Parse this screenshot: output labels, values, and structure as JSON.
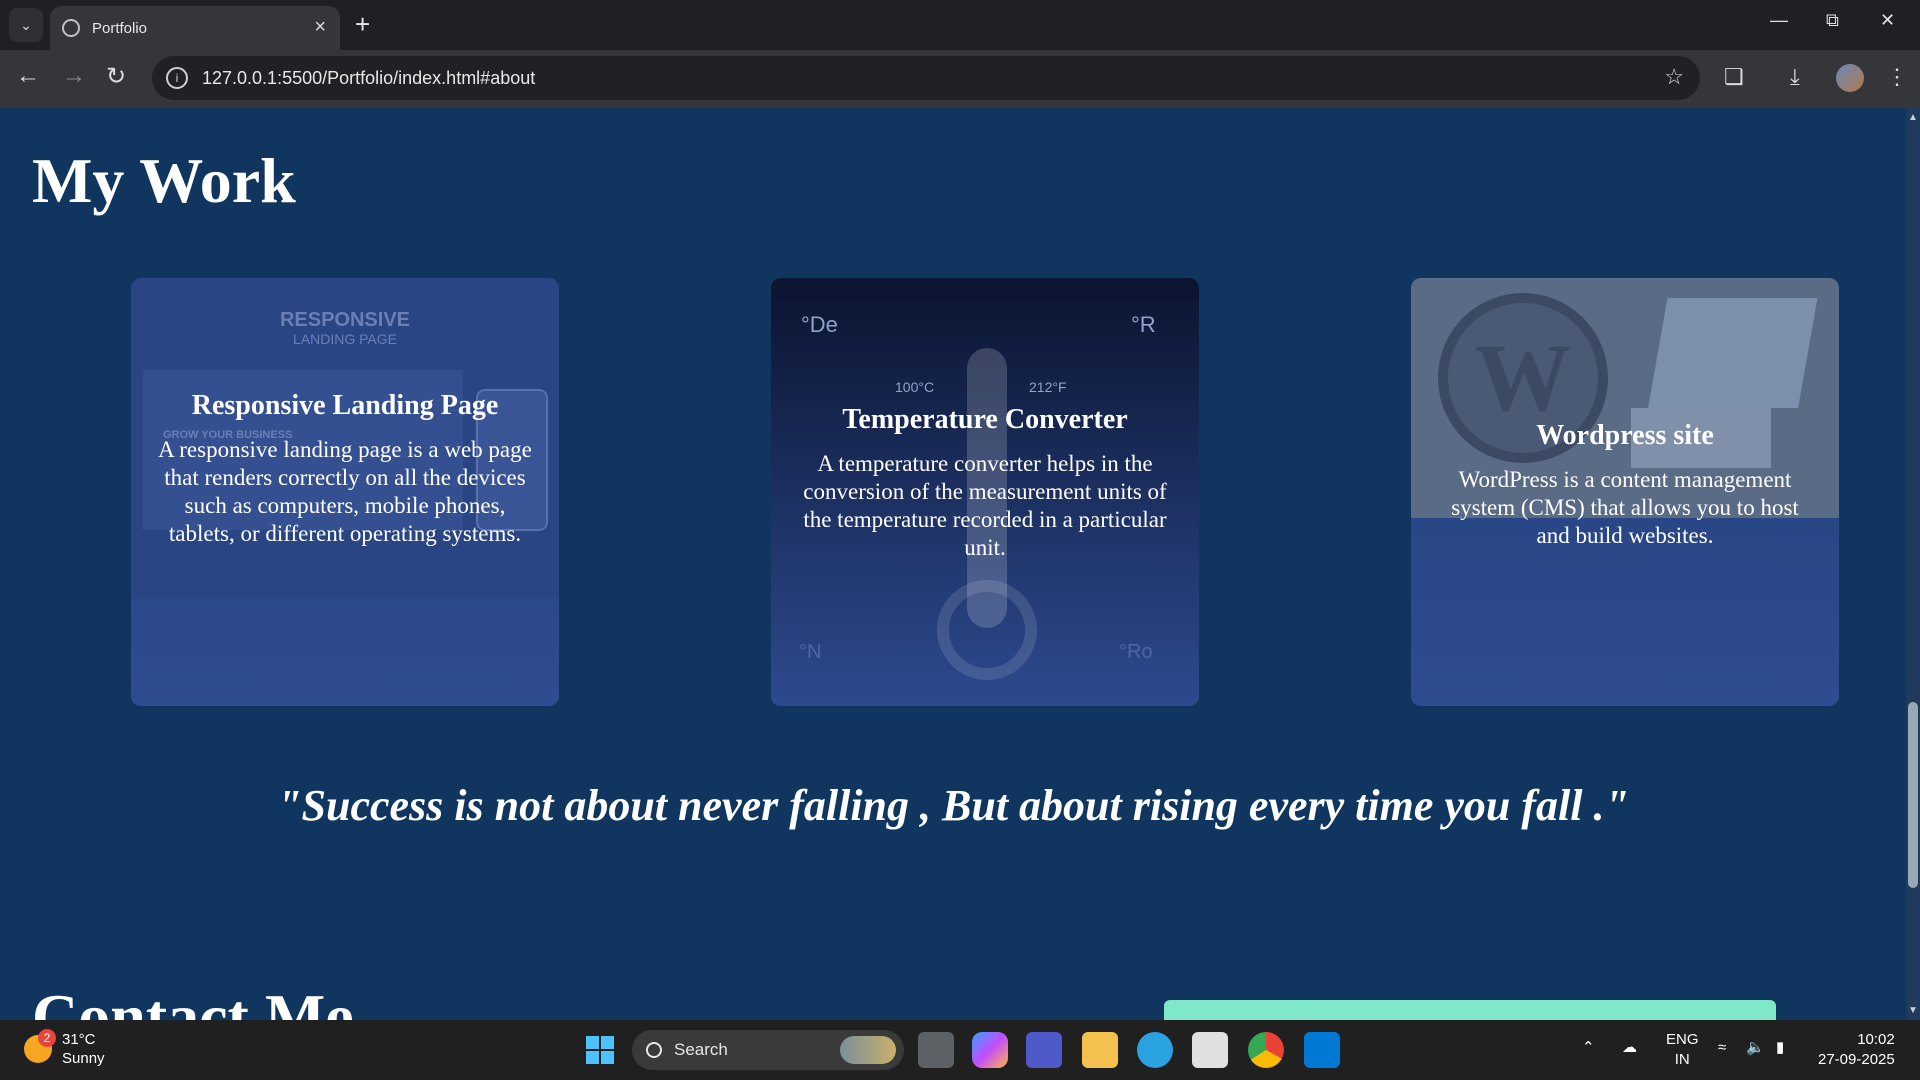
{
  "browser": {
    "tab_title": "Portfolio",
    "url": "127.0.0.1:5500/Portfolio/index.html#about"
  },
  "page": {
    "section_title": "My Work",
    "cards": [
      {
        "title": "Responsive Landing Page",
        "description": "A responsive landing page is a web page that renders correctly on all the devices such as computers, mobile phones, tablets, or different operating systems.",
        "image_heading": "RESPONSIVE",
        "image_subheading": "LANDING PAGE",
        "image_small": "GROW YOUR BUSINESS"
      },
      {
        "title": "Temperature Converter",
        "description": "A temperature converter helps in the conversion of the measurement units of the temperature recorded in a particular unit.",
        "image_labels": [
          "°De",
          "°R",
          "100°C",
          "212°F",
          "°N",
          "°Ro"
        ]
      },
      {
        "title": "Wordpress site",
        "description": "WordPress is a content management system (CMS) that allows you to host and build websites."
      }
    ],
    "quote": "\"Success is not about never falling , But about rising every time you fall .\"",
    "contact_title": "Contact Me"
  },
  "taskbar": {
    "weather_temp": "31°C",
    "weather_desc": "Sunny",
    "weather_badge": "2",
    "search_label": "Search",
    "lang_top": "ENG",
    "lang_bottom": "IN",
    "time": "10:02",
    "date": "27-09-2025"
  }
}
